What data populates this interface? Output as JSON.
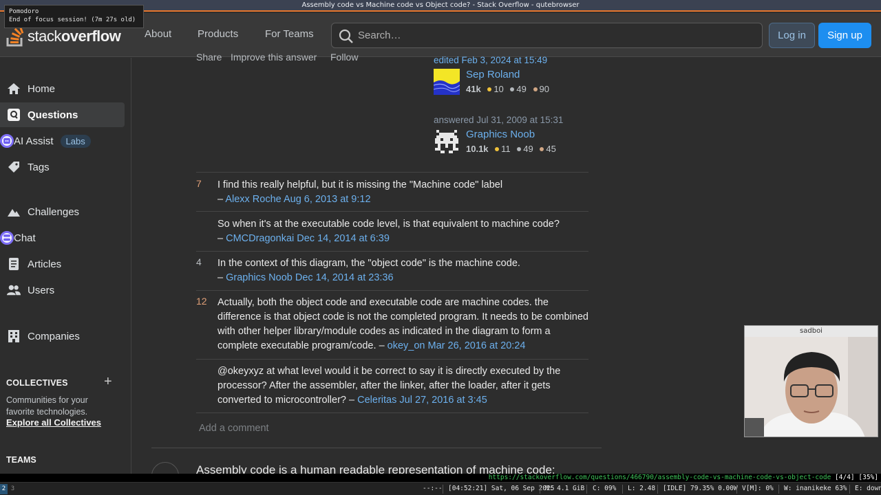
{
  "window": {
    "title": "Assembly code vs Machine code vs Object code? - Stack Overflow - qutebrowser"
  },
  "notification": {
    "title": "Pomodoro",
    "body": "End of focus session! (7m 27s old)"
  },
  "header": {
    "logo_text_light": "stack",
    "logo_text_bold": "overflow",
    "nav": [
      "About",
      "Products",
      "For Teams"
    ],
    "search_placeholder": "Search…",
    "login_label": "Log in",
    "signup_label": "Sign up"
  },
  "sidebar": {
    "items": [
      {
        "label": "Home",
        "icon": "home-icon"
      },
      {
        "label": "Questions",
        "icon": "questions-icon",
        "active": true
      },
      {
        "label": "AI Assist",
        "icon": "ai-assist-icon",
        "badge": "Labs"
      },
      {
        "label": "Tags",
        "icon": "tag-icon"
      },
      {
        "label": "Challenges",
        "icon": "challenges-icon"
      },
      {
        "label": "Chat",
        "icon": "chat-icon"
      },
      {
        "label": "Articles",
        "icon": "articles-icon"
      },
      {
        "label": "Users",
        "icon": "users-icon"
      },
      {
        "label": "Companies",
        "icon": "companies-icon"
      }
    ],
    "collectives_title": "COLLECTIVES",
    "collectives_desc": "Communities for your favorite technologies.",
    "collectives_link": "Explore all Collectives",
    "teams_title": "TEAMS"
  },
  "post_menu": {
    "share": "Share",
    "improve": "Improve this answer",
    "follow": "Follow"
  },
  "editor": {
    "when": "edited Feb 3, 2024 at 15:49",
    "name": "Sep Roland",
    "rep": "41k",
    "gold": "10",
    "silver": "49",
    "bronze": "90"
  },
  "author": {
    "when": "answered Jul 31, 2009 at 15:31",
    "name": "Graphics Noob",
    "rep": "10.1k",
    "gold": "11",
    "silver": "49",
    "bronze": "45"
  },
  "comments": [
    {
      "score": "7",
      "text": "I find this really helpful, but it is missing the \"Machine code\" label",
      "dash": "–",
      "user": "Alexx Roche",
      "date": "Aug 6, 2013 at 9:12"
    },
    {
      "score": "",
      "text": "So when it's at the executable code level, is that equivalent to machine code?",
      "dash": "–",
      "user": "CMCDragonkai",
      "date": "Dec 14, 2014 at 6:39"
    },
    {
      "score": "4",
      "text": "In the context of this diagram, the \"object code\" is the machine code.",
      "dash": "–",
      "user": "Graphics Noob",
      "date": "Dec 14, 2014 at 23:36"
    },
    {
      "score": "12",
      "text": "Actually, both the object code and executable code are machine codes. the difference is that object code is not the completed program. It needs to be combined with other helper library/module codes as indicated in the diagram to form a complete executable program/code.",
      "dash": "–",
      "user": "okey_on",
      "date": "Mar 26, 2016 at 20:24"
    },
    {
      "score": "",
      "text": "@okeyxyz at what level would it be correct to say it is directly executed by the processor? After the assembler, after the linker, after the loader, after it gets converted to microcontroller?",
      "dash": "–",
      "user": "Celeritas",
      "date": "Jul 27, 2016 at 3:45"
    }
  ],
  "add_comment": "Add a comment",
  "next_answer_text": "Assembly code is a human readable representation of machine code:",
  "webcam_label": "sadboi",
  "qute_status": {
    "url": "https://stackoverflow.com/questions/466790/assembly-code-vs-machine-code-vs-object-code",
    "tabs": "[4/4]",
    "scroll": "[35%]"
  },
  "statusbar": {
    "ws_active": "2",
    "ws_other": "3",
    "media": "--:--",
    "clock": "[04:52:21] Sat, 06 Sep 2025",
    "mem": "M: 4.1 GiB",
    "cpu": "C: 09%",
    "load": "L: 2.48",
    "battery": "[IDLE] 79.35% 0.00W",
    "volume": "V[M]: 0%",
    "wifi": "W: inanikeke  63%",
    "eth": "E: down"
  },
  "colors": {
    "accent_orange": "#f48225",
    "link_blue": "#6cb0ed",
    "signup_blue": "#1d8ef0",
    "title_underline": "#e8762d"
  }
}
